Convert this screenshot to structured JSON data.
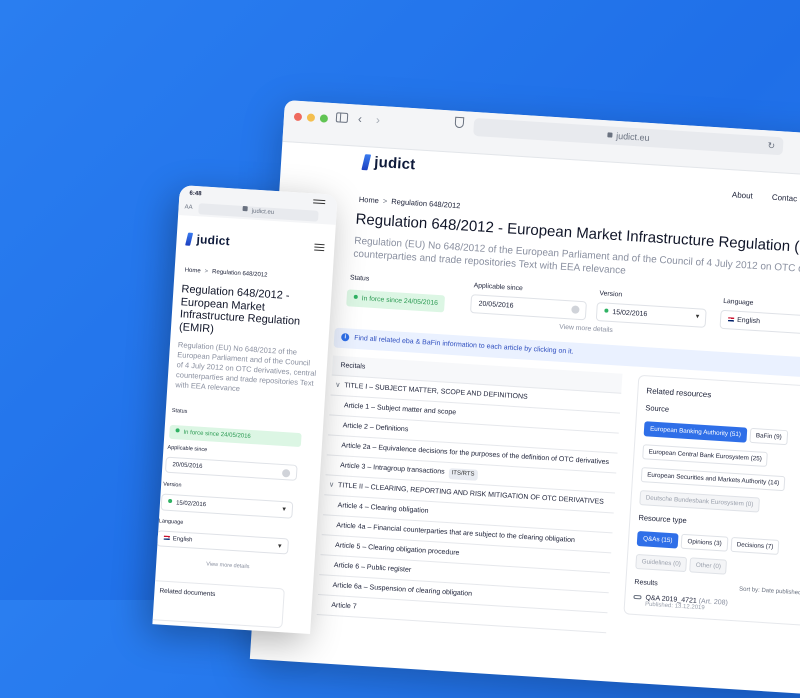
{
  "colors": {
    "background": "#2a7ef0",
    "accent": "#2f6fe8",
    "status_green": "#2fb263",
    "brand_dark": "#0e1a3a"
  },
  "desktop": {
    "url": "judict.eu",
    "logo_text": "judict",
    "nav": {
      "about": "About",
      "contact": "Contac"
    },
    "breadcrumb": {
      "home": "Home",
      "separator": ">",
      "current": "Regulation 648/2012"
    },
    "title": "Regulation 648/2012 - European Market Infrastructure Regulation (",
    "subtitle": "Regulation (EU) No 648/2012 of the European Parliament and of the Council of 4 July 2012 on OTC derivati central counterparties and trade repositories Text with EEA relevance",
    "fields": {
      "status_label": "Status",
      "status_value": "In force since 24/05/2016",
      "applicable_label": "Applicable since",
      "applicable_value": "20/05/2016",
      "version_label": "Version",
      "version_value": "15/02/2016",
      "language_label": "Language",
      "language_value": "English"
    },
    "view_more": "View more details",
    "info_text": "Find all related eba & BaFin information to each article by clicking on it.",
    "toc": [
      {
        "label": "Recitals",
        "head": true
      },
      {
        "label": "TITLE I – SUBJECT MATTER, SCOPE AND DEFINITIONS",
        "chevron": "∨"
      },
      {
        "label": "Article 1 – Subject matter and scope"
      },
      {
        "label": "Article 2 – Definitions"
      },
      {
        "label": "Article 2a – Equivalence decisions for the purposes of the definition of OTC derivatives"
      },
      {
        "label": "Article 3 – Intragroup transactions",
        "tag": "ITS/RTS"
      },
      {
        "label": "TITLE II – CLEARING, REPORTING AND RISK MITIGATION OF OTC DERIVATIVES",
        "chevron": "∨"
      },
      {
        "label": "Article 4 – Clearing obligation"
      },
      {
        "label": "Article 4a – Financial counterparties that are subject to the clearing obligation"
      },
      {
        "label": "Article 5 – Clearing obligation procedure"
      },
      {
        "label": "Article 6 – Public register"
      },
      {
        "label": "Article 6a – Suspension of clearing obligation"
      },
      {
        "label": "Article 7"
      }
    ],
    "related": {
      "title": "Related resources",
      "source_label": "Source",
      "sources": [
        {
          "label": "European Banking Authority (51)",
          "state": "active"
        },
        {
          "label": "BaFin (9)",
          "state": ""
        },
        {
          "label": "European Central Bank Eurosystem (25)",
          "state": ""
        },
        {
          "label": "European Securities and Markets Authority (14)",
          "state": ""
        },
        {
          "label": "Deutsche Bundesbank Eurosystem (0)",
          "state": "dim"
        }
      ],
      "type_label": "Resource type",
      "types": [
        {
          "label": "Q&As (15)",
          "state": "active"
        },
        {
          "label": "Opinions (3)",
          "state": ""
        },
        {
          "label": "Decisions (7)",
          "state": ""
        },
        {
          "label": "Guidelines (0)",
          "state": "dim"
        },
        {
          "label": "Other (0)",
          "state": "dim"
        }
      ],
      "results_label": "Results",
      "sort_label": "Sort by: Date published",
      "result_item": {
        "id": "Q&A 2019_4721",
        "article": "(Art. 208)",
        "published": "Published: 13.12.2019"
      }
    }
  },
  "mobile": {
    "time": "6:48",
    "aa": "AA",
    "url": "judict.eu",
    "logo_text": "judict",
    "breadcrumb": {
      "home": "Home",
      "separator": ">",
      "current": "Regulation 648/2012"
    },
    "title": "Regulation 648/2012 - European Market Infrastructure Regulation (EMIR)",
    "subtitle": "Regulation (EU) No 648/2012 of the European Parliament and of the Council of 4 July 2012 on OTC derivatives, central counterparties and trade repositories Text with EEA relevance",
    "fields": {
      "status_label": "Status",
      "status_value": "In force since 24/05/2016",
      "applicable_label": "Applicable since",
      "applicable_value": "20/05/2016",
      "version_label": "Version",
      "version_value": "15/02/2016",
      "language_label": "Language",
      "language_value": "English"
    },
    "view_more": "View more details",
    "related_documents": "Related documents"
  }
}
